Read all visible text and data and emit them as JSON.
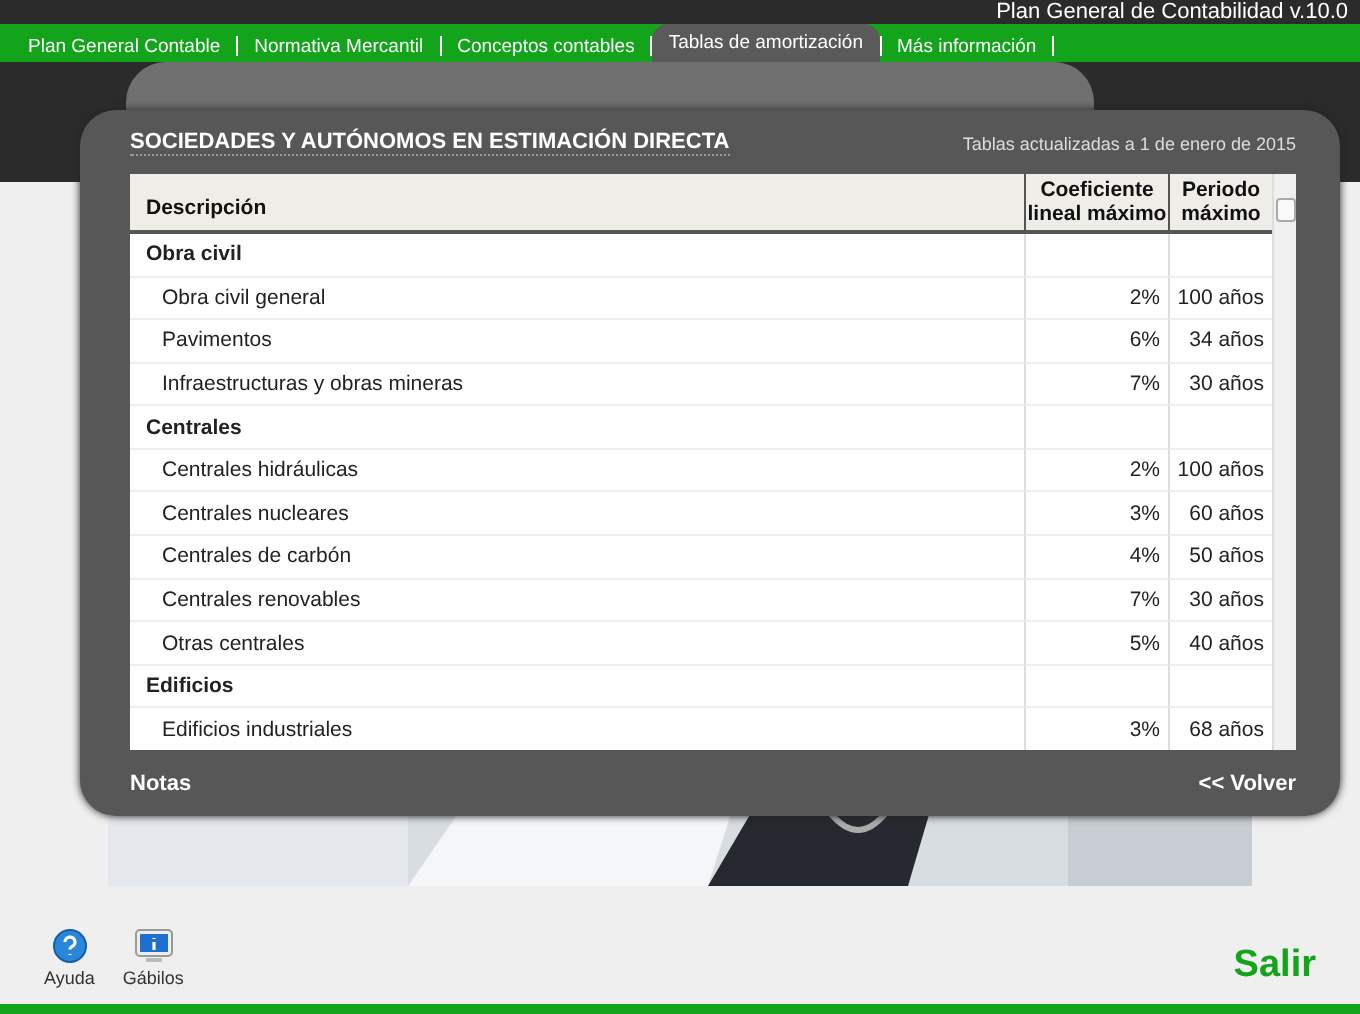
{
  "app_title": "Plan General de Contabilidad v.10.0",
  "nav": [
    {
      "label": "Plan General Contable",
      "selected": false
    },
    {
      "label": "Normativa Mercantil",
      "selected": false
    },
    {
      "label": "Conceptos contables",
      "selected": false
    },
    {
      "label": "Tablas de amortización",
      "selected": true
    },
    {
      "label": "Más información",
      "selected": false
    }
  ],
  "dialog": {
    "title": "SOCIEDADES Y AUTÓNOMOS EN ESTIMACIÓN DIRECTA",
    "updated": "Tablas actualizadas a 1 de enero de 2015",
    "columns": [
      "Descripción",
      "Coeficiente lineal máximo",
      "Periodo máximo"
    ],
    "rows": [
      {
        "kind": "group",
        "description": "Obra civil"
      },
      {
        "kind": "item",
        "description": "Obra civil general",
        "coefficient": "2%",
        "period": "100 años"
      },
      {
        "kind": "item",
        "description": "Pavimentos",
        "coefficient": "6%",
        "period": "34 años"
      },
      {
        "kind": "item",
        "description": "Infraestructuras y obras mineras",
        "coefficient": "7%",
        "period": "30 años"
      },
      {
        "kind": "group",
        "description": "Centrales"
      },
      {
        "kind": "item",
        "description": "Centrales hidráulicas",
        "coefficient": "2%",
        "period": "100 años"
      },
      {
        "kind": "item",
        "description": "Centrales nucleares",
        "coefficient": "3%",
        "period": "60 años"
      },
      {
        "kind": "item",
        "description": "Centrales de carbón",
        "coefficient": "4%",
        "period": "50 años"
      },
      {
        "kind": "item",
        "description": "Centrales renovables",
        "coefficient": "7%",
        "period": "30 años"
      },
      {
        "kind": "item",
        "description": "Otras centrales",
        "coefficient": "5%",
        "period": "40 años"
      },
      {
        "kind": "group",
        "description": "Edificios"
      },
      {
        "kind": "item",
        "description": "Edificios industriales",
        "coefficient": "3%",
        "period": "68 años"
      }
    ],
    "notes_link": "Notas",
    "back_link": "<< Volver"
  },
  "toolbar": [
    {
      "kind": "help",
      "label": "Ayuda"
    },
    {
      "kind": "info",
      "label": "Gábilos"
    }
  ],
  "exit": "Salir"
}
